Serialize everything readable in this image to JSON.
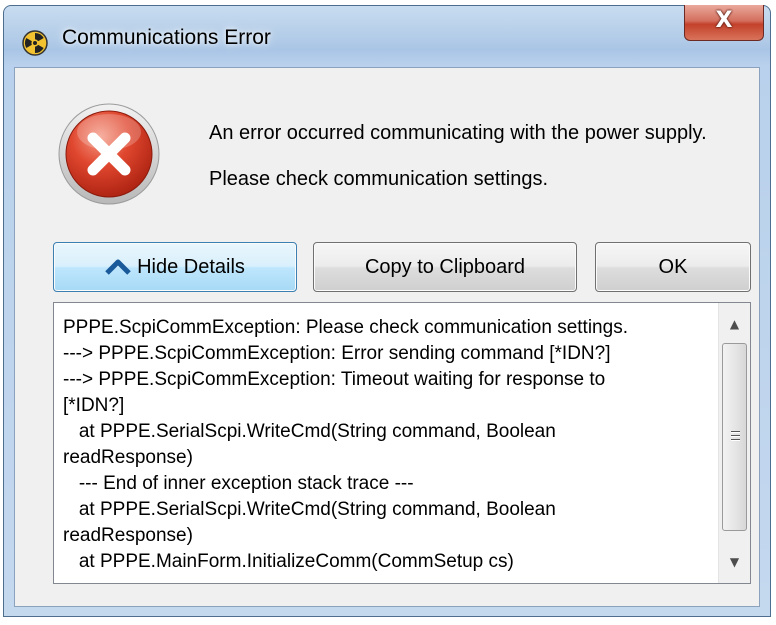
{
  "window": {
    "title": "Communications Error",
    "title_icon": "radiation-icon",
    "close_label": "X"
  },
  "message": {
    "line1": "An error occurred communicating with the power supply.",
    "line2": "Please check communication settings.",
    "icon": "error-icon"
  },
  "buttons": {
    "hide_details": "Hide Details",
    "hide_details_icon": "chevron-up-icon",
    "copy": "Copy to Clipboard",
    "ok": "OK"
  },
  "details": {
    "lines": [
      "PPPE.ScpiCommException: Please check communication settings.",
      "---> PPPE.ScpiCommException: Error sending command [*IDN?]",
      "---> PPPE.ScpiCommException: Timeout waiting for response to",
      "[*IDN?]",
      "   at PPPE.SerialScpi.WriteCmd(String command, Boolean",
      "readResponse)",
      "   --- End of inner exception stack trace ---",
      "   at PPPE.SerialScpi.WriteCmd(String command, Boolean",
      "readResponse)",
      "   at PPPE.MainForm.InitializeComm(CommSetup cs)"
    ]
  },
  "colors": {
    "error_red": "#d3331f",
    "focus_blue": "#3c7fb1",
    "close_red": "#c3412b"
  }
}
